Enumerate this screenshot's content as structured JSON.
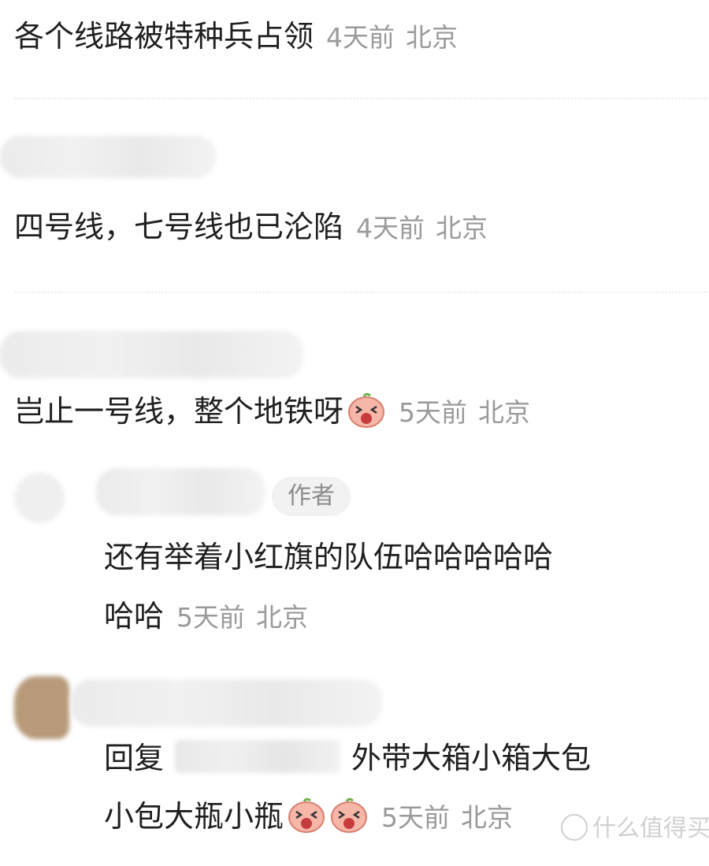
{
  "comments": [
    {
      "text": "各个线路被特种兵占领",
      "time": "4天前",
      "location": "北京"
    },
    {
      "text": "四号线，七号线也已沦陷",
      "time": "4天前",
      "location": "北京"
    },
    {
      "text": "岂止一号线，整个地铁呀",
      "emoji": "laughing-face-emoji",
      "time": "5天前",
      "location": "北京"
    },
    {
      "author_badge": "作者",
      "text_line1": "还有举着小红旗的队伍哈哈哈哈哈",
      "text_line2": "哈哈",
      "time": "5天前",
      "location": "北京"
    },
    {
      "reply_prefix": "回复",
      "text_line1": "外带大箱小箱大包",
      "text_line2": "小包大瓶小瓶",
      "emoji": "laughing-face-emoji",
      "time": "5天前",
      "location": "北京"
    }
  ],
  "watermark": {
    "text": "什么值得买"
  },
  "colors": {
    "text": "#1f1f1f",
    "meta": "#9a9a9a",
    "badge_bg": "#f2f2f2"
  }
}
